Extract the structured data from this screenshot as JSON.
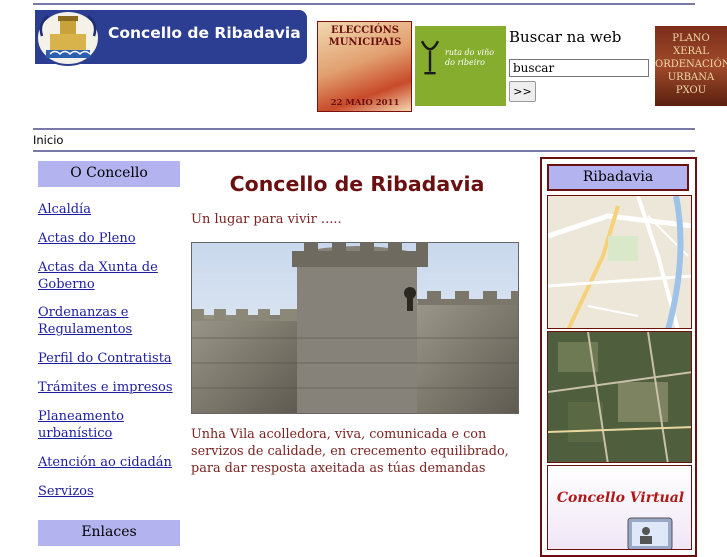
{
  "header": {
    "site_name": "Concello de Ribadavia",
    "banners": {
      "elections": {
        "title": "ELECCIÓNS MUNICIPAIS",
        "date": "22 MAIO 2011"
      },
      "wine_route": {
        "text": "ruta do viño do ribeiro"
      },
      "urban_plan": {
        "text": "PLANO XERAL ORDENACIÓN URBANA PXOU"
      }
    },
    "search": {
      "label": "Buscar na web",
      "input_value": "buscar",
      "button_label": ">>"
    }
  },
  "breadcrumb": "Inicio",
  "sidebar": {
    "heading": "O Concello",
    "items": [
      {
        "label": "Alcaldía"
      },
      {
        "label": "Actas do Pleno"
      },
      {
        "label": "Actas da Xunta de Goberno"
      },
      {
        "label": "Ordenanzas e Regulamentos"
      },
      {
        "label": "Perfil do Contratista"
      },
      {
        "label": "Trámites e impresos"
      },
      {
        "label": "Planeamento urbanístico"
      },
      {
        "label": "Atención ao cidadán"
      },
      {
        "label": "Servizos"
      }
    ],
    "links_heading": "Enlaces"
  },
  "main": {
    "title": "Concello de Ribadavia",
    "tagline": "Un lugar para vivir .....",
    "description": "Unha Vila acolledora, viva, comunicada e con servizos de calidade, en crecemento equilibrado, para dar resposta axeitada as túas demandas"
  },
  "right_panel": {
    "heading": "Ribadavia",
    "virtual_label": "Concello Virtual"
  },
  "colors": {
    "logo_bg": "#2c3e92",
    "sidebar_heading_bg": "#b3b3f0",
    "link": "#1d1da0",
    "title": "#6b1010",
    "panel_border": "#6b0f0f"
  }
}
